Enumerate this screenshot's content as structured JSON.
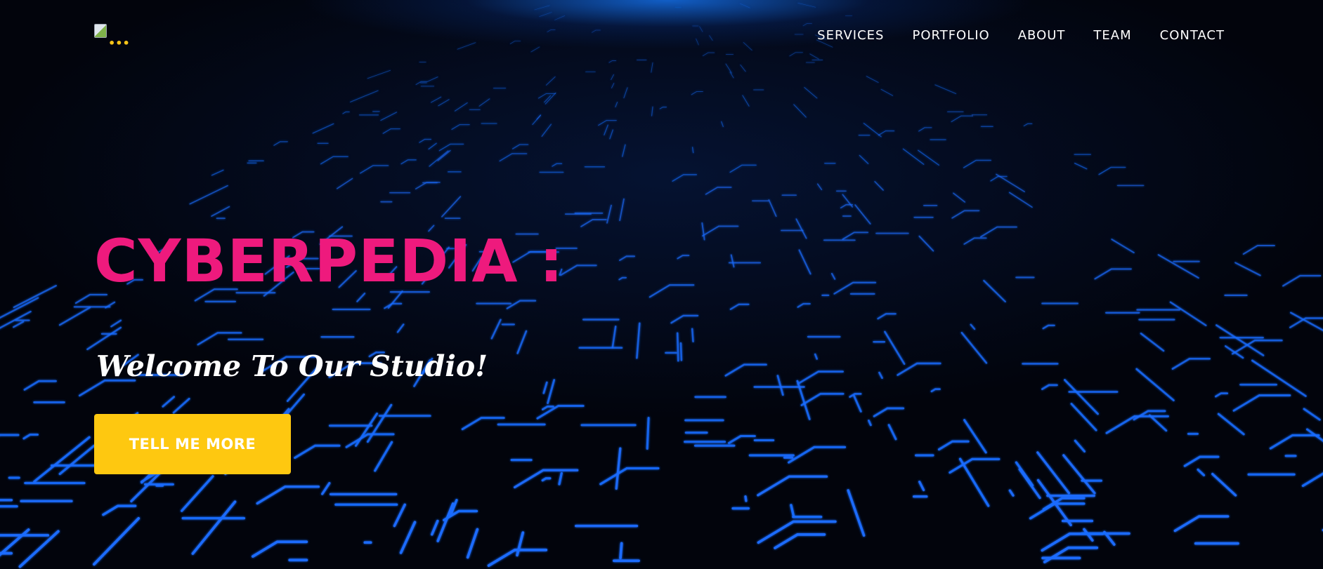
{
  "nav": {
    "items": [
      {
        "label": "SERVICES"
      },
      {
        "label": "PORTFOLIO"
      },
      {
        "label": "ABOUT"
      },
      {
        "label": "TEAM"
      },
      {
        "label": "CONTACT"
      }
    ]
  },
  "logo": {
    "icon": "broken-image-icon",
    "dots": "•••"
  },
  "hero": {
    "title": "CYBERPEDIA :",
    "subtitle": "Welcome To Our Studio!",
    "cta_label": "TELL ME MORE"
  },
  "colors": {
    "background": "#02040c",
    "circuit": "#1a6cff",
    "glow": "#146ee6",
    "title": "#ee1a7d",
    "button": "#fec810",
    "nav_text": "#ffffff"
  }
}
